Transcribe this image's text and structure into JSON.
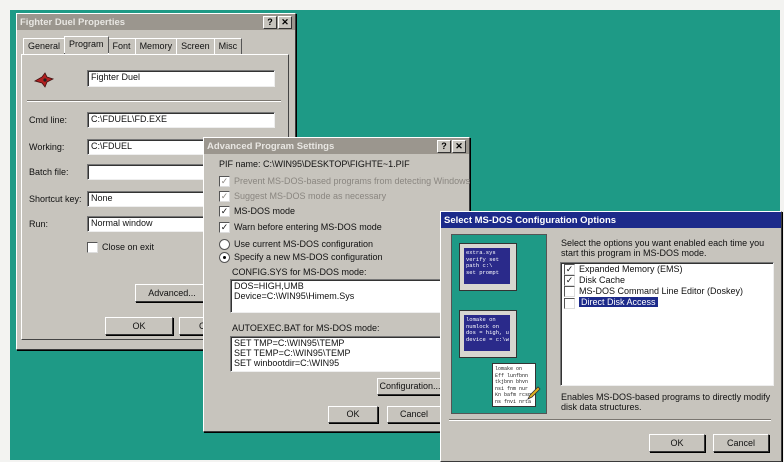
{
  "props": {
    "title": "Fighter Duel Properties",
    "help": "?",
    "close": "✕",
    "tabs": [
      "General",
      "Program",
      "Font",
      "Memory",
      "Screen",
      "Misc"
    ],
    "name_value": "Fighter Duel",
    "cmd_label": "Cmd line:",
    "cmd_value": "C:\\FDUEL\\FD.EXE",
    "working_label": "Working:",
    "working_value": "C:\\FDUEL",
    "batch_label": "Batch file:",
    "batch_value": "",
    "shortcut_label": "Shortcut key:",
    "shortcut_value": "None",
    "run_label": "Run:",
    "run_value": "Normal window",
    "close_on_exit": "Close on exit",
    "advanced": "Advanced...",
    "ok": "OK",
    "cancel": "Cancel"
  },
  "adv": {
    "title": "Advanced Program Settings",
    "help": "?",
    "close": "✕",
    "pif_name": "PIF name:  C:\\WIN95\\DESKTOP\\FIGHTE~1.PIF",
    "opt1": "Prevent MS-DOS-based programs from detecting Windows",
    "opt2": "Suggest MS-DOS mode as necessary",
    "opt3": "MS-DOS mode",
    "opt4": "Warn before entering MS-DOS mode",
    "opt5": "Use current MS-DOS configuration",
    "opt6": "Specify a new MS-DOS configuration",
    "config_label": "CONFIG.SYS for MS-DOS mode:",
    "config_lines": [
      "DOS=HIGH,UMB",
      "Device=C:\\WIN95\\Himem.Sys"
    ],
    "autoexec_label": "AUTOEXEC.BAT for MS-DOS mode:",
    "autoexec_lines": [
      "SET TMP=C:\\WIN95\\TEMP",
      "SET TEMP=C:\\WIN95\\TEMP",
      "SET winbootdir=C:\\WIN95"
    ],
    "configuration": "Configuration...",
    "ok": "OK",
    "cancel": "Cancel"
  },
  "sel": {
    "title": "Select MS-DOS Configuration Options",
    "instructions": "Select the options you want enabled each time you start this program in MS-DOS mode.",
    "options": [
      "Expanded Memory (EMS)",
      "Disk Cache",
      "MS-DOS Command Line Editor (Doskey)",
      "Direct Disk Access"
    ],
    "description": "Enables MS-DOS-based programs to directly modify disk data structures.",
    "ok": "OK",
    "cancel": "Cancel",
    "art_text1": [
      "extra.sys",
      "verify set",
      "path c:\\",
      "set prompt"
    ],
    "art_text2": [
      "lomake on",
      "numlock on",
      "dos = high, u",
      "device = c:\\w"
    ],
    "art_text3": [
      "lomake on",
      "Eff lunfbnn",
      "tkjbnn bhvn",
      "nsi fnm nur",
      "Kn bafm rcsn",
      "ns fnvi nrta"
    ]
  },
  "colors": {
    "desktop": "#1e9a86",
    "title_active": "#1c2a8a",
    "title_inactive": "#9b968e",
    "selection": "#1c2a8a"
  }
}
